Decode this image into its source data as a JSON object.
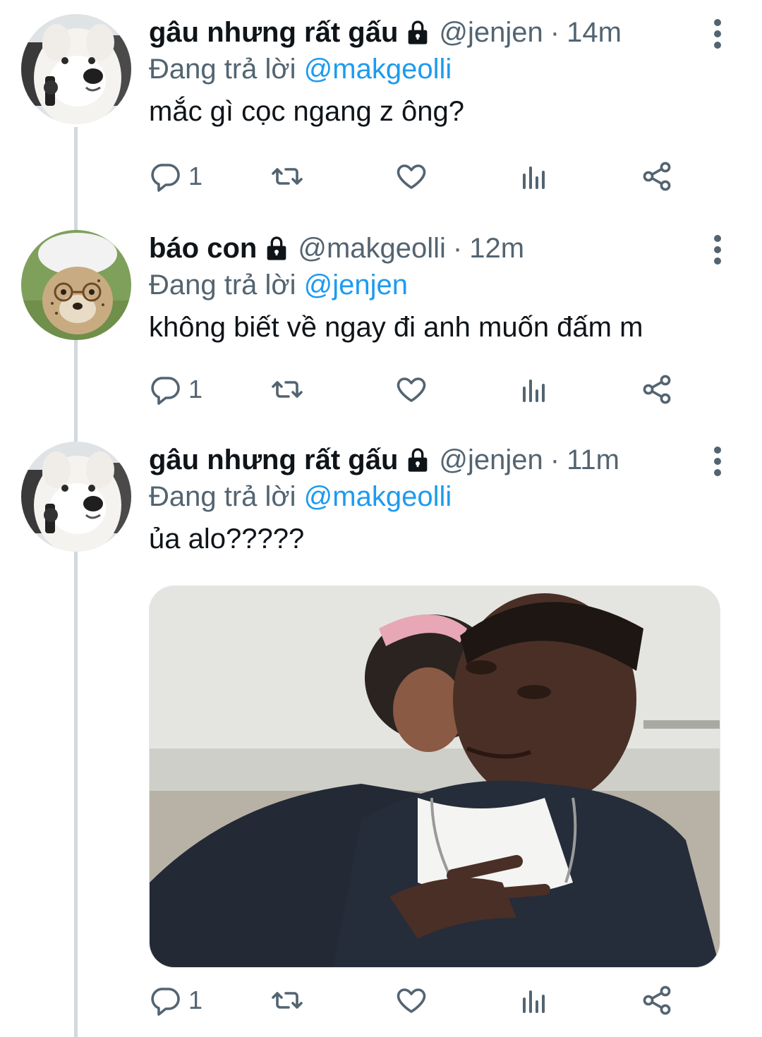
{
  "tweets": [
    {
      "display_name": "gâu nhưng rất gấu",
      "handle": "@jenjen",
      "separator": "·",
      "time": "14m",
      "replying_prefix": "Đang trả lời",
      "replying_to": "@makgeolli",
      "text": "mắc gì cọc ngang z ông?",
      "reply_count": "1",
      "avatar": "dog-avatar-icon"
    },
    {
      "display_name": "báo con",
      "handle": "@makgeolli",
      "separator": "·",
      "time": "12m",
      "replying_prefix": "Đang trả lời",
      "replying_to": "@jenjen",
      "text": "không biết về ngay đi anh muốn đấm m",
      "reply_count": "1",
      "avatar": "cheetah-cub-avatar-icon"
    },
    {
      "display_name": "gâu nhưng rất gấu",
      "handle": "@jenjen",
      "separator": "·",
      "time": "11m",
      "replying_prefix": "Đang trả lời",
      "replying_to": "@makgeolli",
      "text": "ủa alo?????",
      "reply_count": "1",
      "avatar": "dog-avatar-icon",
      "has_media": true
    }
  ],
  "icons": {
    "lock": "lock-icon",
    "more": "more-vertical-icon",
    "reply": "reply-icon",
    "retweet": "retweet-icon",
    "like": "heart-icon",
    "views": "analytics-icon",
    "share": "share-icon"
  },
  "colors": {
    "link": "#1d9bf0",
    "secondary": "#536471",
    "primary_text": "#0f1419",
    "thread_line": "#cfd9de"
  }
}
